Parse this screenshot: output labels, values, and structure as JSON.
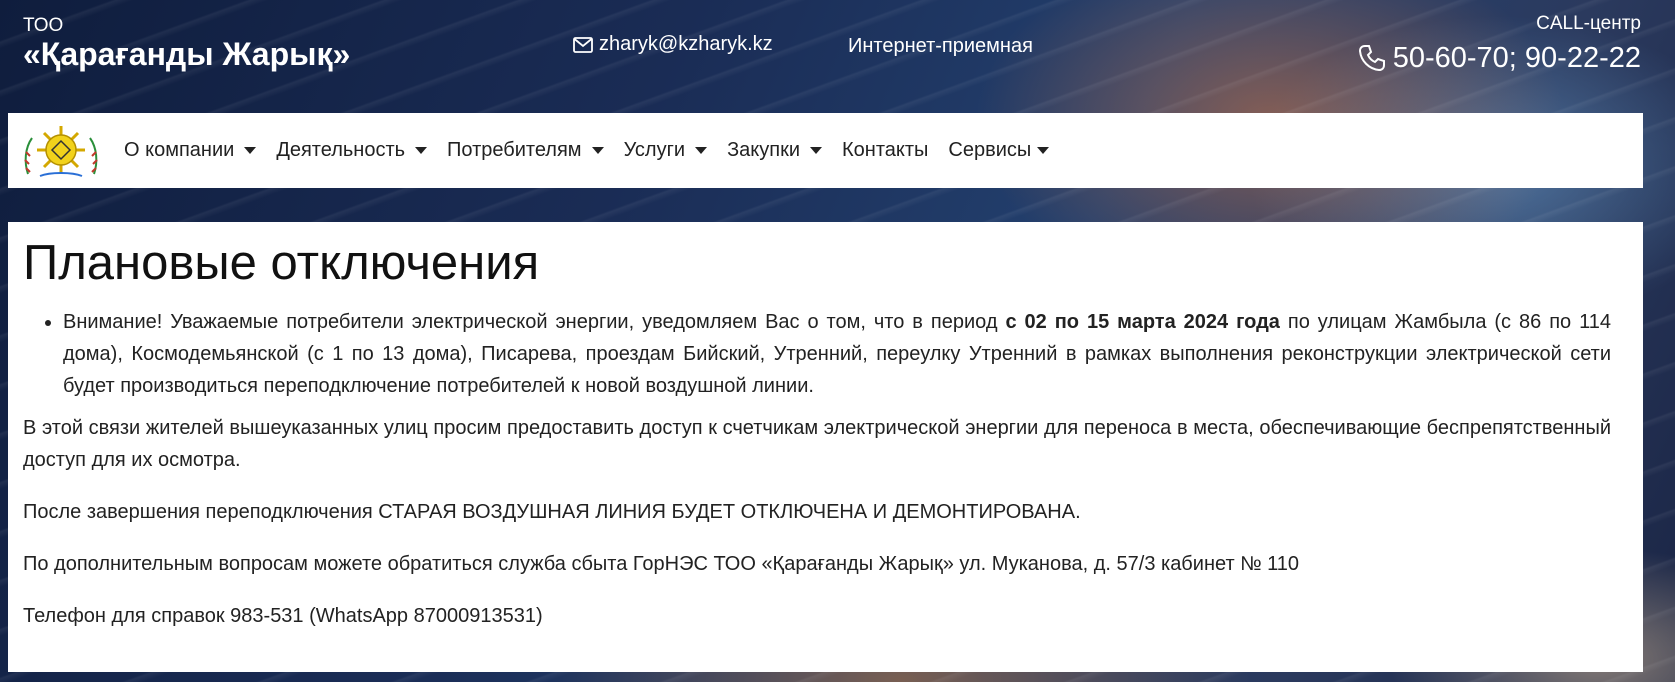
{
  "header": {
    "brand_small": "ТОО",
    "brand_name": "«Қарағанды Жарық»",
    "email": "zharyk@kzharyk.kz",
    "reception": "Интернет-приемная",
    "call_label": "CALL-центр",
    "call_phones": "50-60-70; 90-22-22"
  },
  "nav": {
    "items": [
      {
        "label": "О компании",
        "dropdown": true
      },
      {
        "label": "Деятельность",
        "dropdown": true
      },
      {
        "label": "Потребителям",
        "dropdown": true
      },
      {
        "label": "Услуги",
        "dropdown": true
      },
      {
        "label": "Закупки",
        "dropdown": true
      },
      {
        "label": "Контакты",
        "dropdown": false
      },
      {
        "label": "Сервисы",
        "dropdown": true
      }
    ]
  },
  "main": {
    "title": "Плановые отключения",
    "notice": {
      "pre": "Внимание! Уважаемые потребители электрической энергии, уведомляем Вас о том, что в период ",
      "bold": "с 02 по 15 марта 2024 года",
      "post": " по улицам Жамбыла (с 86 по 114 дома), Космодемьянской (с 1 по 13 дома), Писарева, проездам Бийский, Утренний, переулку Утренний в рамках выполнения реконструкции электрической сети будет производиться переподключение потребителей к новой воздушной линии."
    },
    "paragraphs": [
      "В этой связи жителей вышеуказанных улиц просим предоставить доступ к счетчикам электрической энергии для переноса в места, обеспечивающие беспрепятственный доступ для их осмотра.",
      "После завершения переподключения СТАРАЯ ВОЗДУШНАЯ ЛИНИЯ БУДЕТ ОТКЛЮЧЕНА И ДЕМОНТИРОВАНА.",
      "По дополнительным вопросам можете обратиться служба сбыта ГорНЭС ТОО «Қарағанды Жарық» ул. Муканова, д. 57/3 кабинет № 110",
      "Телефон для справок 983-531 (WhatsApp 87000913531)"
    ]
  },
  "colors": {
    "header_bg": "#1a2c55",
    "panel_bg": "#ffffff",
    "text": "#222222",
    "logo_yellow": "#f2d21b"
  },
  "icons": [
    "envelope-icon",
    "phone-icon",
    "company-logo",
    "caret-down-icon"
  ]
}
